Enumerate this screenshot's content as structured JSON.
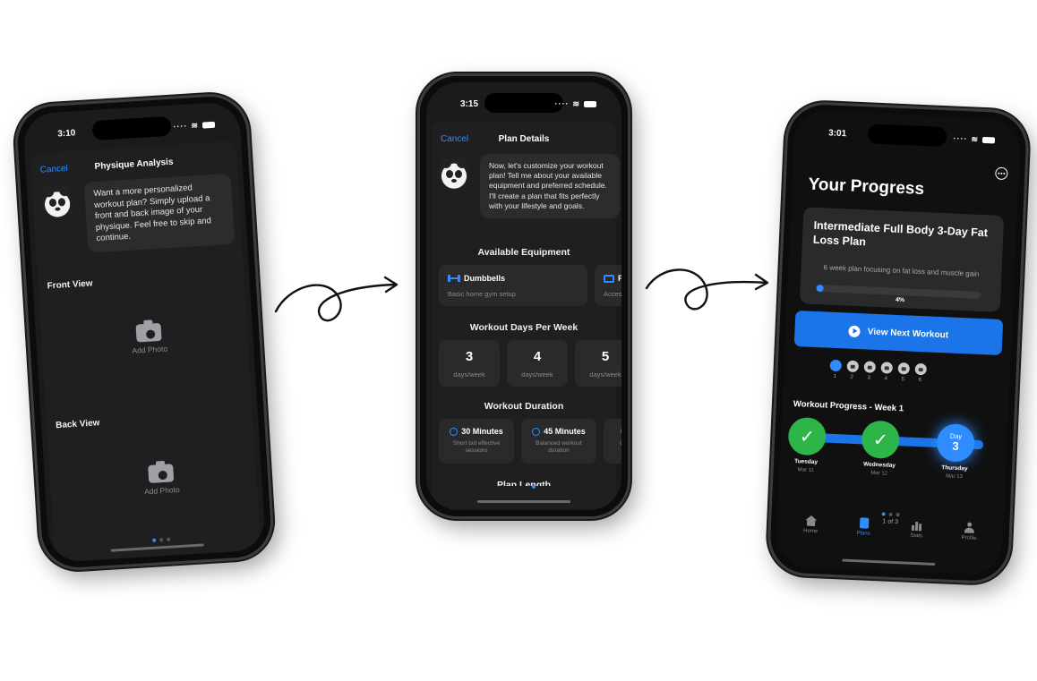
{
  "phone1": {
    "time": "3:10",
    "nav": {
      "cancel": "Cancel",
      "title": "Physique Analysis"
    },
    "message": "Want a more personalized workout plan? Simply upload a front and back image of your physique. Feel free to skip and continue.",
    "front_label": "Front View",
    "back_label": "Back View",
    "add_photo": "Add Photo"
  },
  "phone2": {
    "time": "3:15",
    "nav": {
      "cancel": "Cancel",
      "title": "Plan Details"
    },
    "message": "Now, let's customize your workout plan! Tell me about your available equipment and preferred schedule. I'll create a plan that fits perfectly with your lifestyle and goals.",
    "equipment_heading": "Available Equipment",
    "equipment": [
      {
        "title": "Dumbbells",
        "subtitle": "Basic home gym setup",
        "icon": "dumbbell-icon"
      },
      {
        "title": "F",
        "subtitle": "Access",
        "icon": "gym-icon"
      }
    ],
    "days_heading": "Workout Days Per Week",
    "days": [
      {
        "num": "3",
        "unit": "days/week"
      },
      {
        "num": "4",
        "unit": "days/week"
      },
      {
        "num": "5",
        "unit": "days/week"
      }
    ],
    "duration_heading": "Workout Duration",
    "durations": [
      {
        "title": "30 Minutes",
        "subtitle": "Short but effective sessions"
      },
      {
        "title": "45 Minutes",
        "subtitle": "Balanced workout duration"
      },
      {
        "title": "",
        "subtitle": "Com"
      }
    ],
    "next_heading": "Plan Length"
  },
  "phone3": {
    "time": "3:01",
    "title": "Your Progress",
    "plan_title": "Intermediate Full Body 3-Day Fat Loss Plan",
    "plan_desc": "6 week plan focusing on fat loss and muscle gain",
    "progress_pct": "4%",
    "progress_value": 0.04,
    "cta": "View Next Workout",
    "weeks": [
      "1",
      "2",
      "3",
      "4",
      "5",
      "6"
    ],
    "current_week": 1,
    "week_title": "Workout Progress - Week 1",
    "days": [
      {
        "label": "Tuesday",
        "date": "Mar 11",
        "status": "done"
      },
      {
        "label": "Wednesday",
        "date": "Mar 12",
        "status": "done"
      },
      {
        "label": "Thursday",
        "date": "Mar 13",
        "status": "today",
        "day_word": "Day",
        "day_num": "3"
      }
    ],
    "page_text": "1 of 3",
    "tabs": [
      {
        "label": "Home",
        "active": false
      },
      {
        "label": "Plans",
        "active": true
      },
      {
        "label": "Stats",
        "active": false
      },
      {
        "label": "Profile",
        "active": false
      }
    ]
  },
  "colors": {
    "accent": "#2f8cff",
    "success": "#2db54a",
    "background": "#1b1b1d"
  }
}
